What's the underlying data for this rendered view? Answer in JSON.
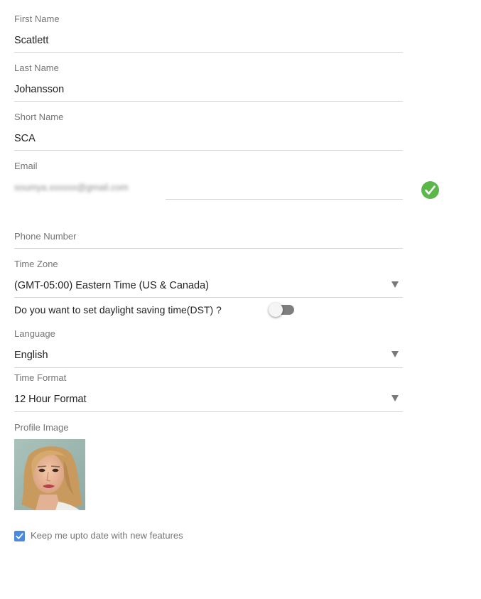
{
  "form": {
    "first_name": {
      "label": "First Name",
      "value": "Scatlett"
    },
    "last_name": {
      "label": "Last Name",
      "value": "Johansson"
    },
    "short_name": {
      "label": "Short Name",
      "value": "SCA"
    },
    "email": {
      "label": "Email",
      "value": "soumya.xxxxxx@gmail.com",
      "status_icon": "check-circle-icon",
      "status_color": "#5bb74a"
    },
    "phone_number": {
      "label": "Phone Number",
      "value": ""
    },
    "time_zone": {
      "label": "Time Zone",
      "value": "(GMT-05:00) Eastern Time (US & Canada)"
    },
    "dst": {
      "label": "Do you want to set daylight saving time(DST) ?",
      "enabled": false
    },
    "language": {
      "label": "Language",
      "value": "English"
    },
    "time_format": {
      "label": "Time Format",
      "value": "12 Hour Format"
    },
    "profile_image": {
      "label": "Profile Image"
    },
    "newsletter": {
      "label": "Keep me upto date with new features",
      "checked": true,
      "color": "#4a89dc"
    }
  }
}
